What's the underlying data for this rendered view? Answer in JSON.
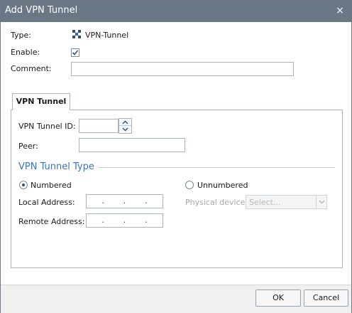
{
  "dialog": {
    "title": "Add VPN Tunnel",
    "close_icon": "×"
  },
  "form": {
    "type_label": "Type:",
    "type_value": "VPN-Tunnel",
    "type_icon": "vpn-tunnel-icon",
    "enable_label": "Enable:",
    "enable_checked": true,
    "comment_label": "Comment:",
    "comment_value": ""
  },
  "tabs": [
    {
      "label": "VPN Tunnel",
      "active": true
    }
  ],
  "tunnel": {
    "id_label": "VPN Tunnel ID:",
    "id_value": "",
    "peer_label": "Peer:",
    "peer_value": "",
    "section_title": "VPN Tunnel Type",
    "numbered_label": "Numbered",
    "numbered_selected": true,
    "unnumbered_label": "Unnumbered",
    "unnumbered_selected": false,
    "local_address_label": "Local Address:",
    "remote_address_label": "Remote Address:",
    "physical_device_label": "Physical device:",
    "physical_device_placeholder": "Select..."
  },
  "buttons": {
    "ok": "OK",
    "cancel": "Cancel"
  },
  "colors": {
    "titlebar": "#6a7785",
    "section_title": "#3b73b9"
  }
}
